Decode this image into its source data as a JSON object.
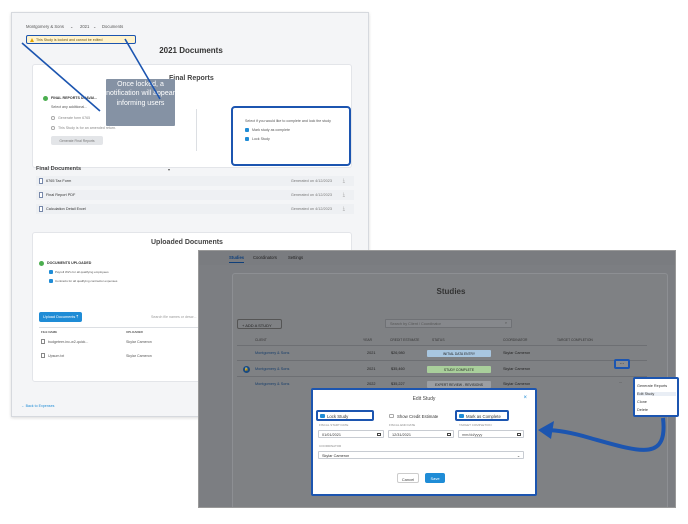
{
  "back": {
    "breadcrumb": [
      "Montgomery & Sons",
      "2021",
      "Documents"
    ],
    "lock_banner": "This Study is locked and cannot be edited",
    "page_title": "2021 Documents",
    "final_reports": {
      "title": "Final Reports",
      "status": "FINAL REPORTS UNAVAI...",
      "additional": "Select any additional...",
      "option1": "Generate form 6765",
      "option2": "This Study is for an amended return.",
      "generate_button": "Generate Final Reports",
      "lock_prompt": "Select if you would like to complete and lock the study",
      "mark_complete": "Mark study as complete",
      "lock_study": "Lock Study"
    },
    "tooltip": "Once locked, a notification will appear informing users",
    "final_documents": {
      "title": "Final Documents",
      "rows": [
        {
          "name": "6765 Tax Form",
          "generated": "Generated on 4/12/2023"
        },
        {
          "name": "Final Report PDF",
          "generated": "Generated on 4/12/2023"
        },
        {
          "name": "Calculation Detail Excel",
          "generated": "Generated on 4/12/2023"
        }
      ]
    },
    "uploaded": {
      "title": "Uploaded Documents",
      "status": "DOCUMENTS UPLOADED",
      "item1": "Payroll W2's for all qualifying employees",
      "item2": "Contracts for all qualifying contractor expenses",
      "upload_button": "Upload Documents",
      "search_placeholder": "Search file names or descr...",
      "col_file": "FILE NAME",
      "col_uploader": "UPLOADER",
      "files": [
        {
          "name": "budgeteer-inc-w2-quick...",
          "uploader": "Skylar Cameron"
        },
        {
          "name": "Upsum.txt",
          "uploader": "Skylar Cameron"
        }
      ]
    },
    "back_link": "Back to Expenses"
  },
  "front": {
    "tabs": [
      "Studies",
      "Coordinators",
      "Settings"
    ],
    "title": "Studies",
    "add_study": "ADD A STUDY",
    "search_placeholder": "Search by Client / Coordinator",
    "headers": [
      "CLIENT",
      "YEAR",
      "CREDIT ESTIMATE",
      "STATUS",
      "COORDINATOR",
      "TARGET COMPLETION"
    ],
    "rows": [
      {
        "client": "Montgomery & Sons",
        "year": "2021",
        "credit": "$26,980",
        "status": "INITIAL DATA ENTRY",
        "status_color": "#a8c6e0",
        "coordinator": "Skylar Cameron",
        "more": ""
      },
      {
        "client": "Montgomery & Sons",
        "year": "2021",
        "credit": "$35,460",
        "status": "STUDY COMPLETE",
        "status_color": "#a9cf9b",
        "coordinator": "Skylar Cameron",
        "more": "..."
      },
      {
        "client": "Montgomery & Sons",
        "year": "2022",
        "credit": "$35,227",
        "status": "EXPERT REVIEW - REVISIONS",
        "status_color": "#9c9fa3",
        "coordinator": "Skylar Cameron",
        "more": "..."
      }
    ],
    "menu": [
      "Generate Reports",
      "Edit Study",
      "Clone",
      "Delete"
    ],
    "modal": {
      "title": "Edit Study",
      "lock_study": "Lock Study",
      "show_credit": "Show Credit Estimate",
      "mark_complete": "Mark as Complete",
      "label_start": "FISCAL START DATE",
      "label_end": "FISCAL END DATE",
      "label_target": "TARGET COMPLETION",
      "start_date": "01/01/2021",
      "end_date": "12/31/2021",
      "target_placeholder": "mm/dd/yyyy",
      "label_coordinator": "COORDINATOR",
      "coordinator": "Skylar Cameron",
      "cancel": "Cancel",
      "save": "Save"
    }
  },
  "colors": {
    "accent": "#1f8cd6",
    "annotation": "#1c55b0",
    "success": "#4bae4f"
  }
}
